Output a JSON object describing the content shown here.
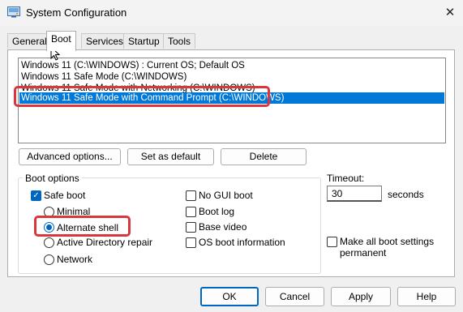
{
  "window": {
    "title": "System Configuration",
    "close_glyph": "✕"
  },
  "tabs": [
    {
      "label": "General"
    },
    {
      "label": "Boot"
    },
    {
      "label": "Services"
    },
    {
      "label": "Startup"
    },
    {
      "label": "Tools"
    }
  ],
  "active_tab": "Boot",
  "os_list": [
    "Windows 11 (C:\\WINDOWS) : Current OS; Default OS",
    "Windows 11 Safe Mode (C:\\WINDOWS)",
    "Windows 11 Safe Mode with Networking (C:\\WINDOWS)",
    "Windows 11 Safe Mode with Command Prompt (C:\\WINDOWS)"
  ],
  "selected_os_index": 3,
  "list_buttons": {
    "advanced": "Advanced options...",
    "set_default": "Set as default",
    "delete": "Delete"
  },
  "boot_options": {
    "group_label": "Boot options",
    "safe_boot": {
      "label": "Safe boot",
      "checked": true
    },
    "minimal": {
      "label": "Minimal",
      "checked": false
    },
    "alternate_shell": {
      "label": "Alternate shell",
      "checked": true
    },
    "active_directory_repair": {
      "label": "Active Directory repair",
      "checked": false
    },
    "network": {
      "label": "Network",
      "checked": false
    },
    "no_gui_boot": {
      "label": "No GUI boot",
      "checked": false
    },
    "boot_log": {
      "label": "Boot log",
      "checked": false
    },
    "base_video": {
      "label": "Base video",
      "checked": false
    },
    "os_boot_information": {
      "label": "OS boot information",
      "checked": false
    }
  },
  "timeout": {
    "label": "Timeout:",
    "value": "30",
    "unit": "seconds"
  },
  "make_permanent": {
    "line1": "Make all boot settings",
    "line2": "permanent",
    "checked": false
  },
  "dialog_buttons": {
    "ok": "OK",
    "cancel": "Cancel",
    "apply": "Apply",
    "help": "Help"
  },
  "colors": {
    "selection": "#0078d7",
    "highlight_box": "#d9363e",
    "accent": "#0067c0"
  }
}
